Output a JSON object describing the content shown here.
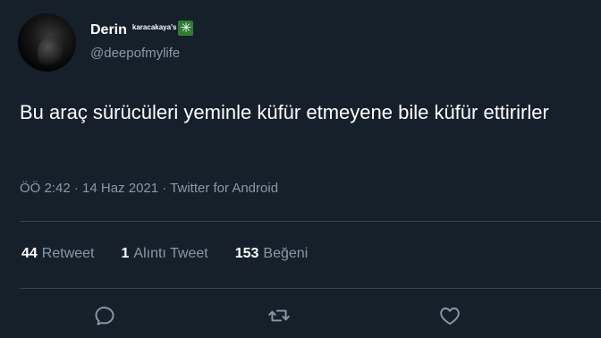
{
  "author": {
    "display_name": "Derin",
    "name_suffix": "karacakaya's",
    "badge_icon": "sparkle-icon",
    "handle": "@deepofmylife"
  },
  "tweet": {
    "text": "Bu araç sürücüleri yeminle küfür etmeyene bile küfür ettirirler",
    "meta": "ÖÖ 2:42 · 14 Haz 2021 · Twitter for Android"
  },
  "stats": {
    "retweets_count": "44",
    "retweets_label": "Retweet",
    "quotes_count": "1",
    "quotes_label": "Alıntı Tweet",
    "likes_count": "153",
    "likes_label": "Beğeni"
  },
  "actions": {
    "reply_icon": "reply-icon",
    "retweet_icon": "retweet-icon",
    "like_icon": "heart-icon"
  },
  "colors": {
    "background": "#15202b",
    "secondary_text": "#8899a6",
    "divider": "#38444d"
  }
}
